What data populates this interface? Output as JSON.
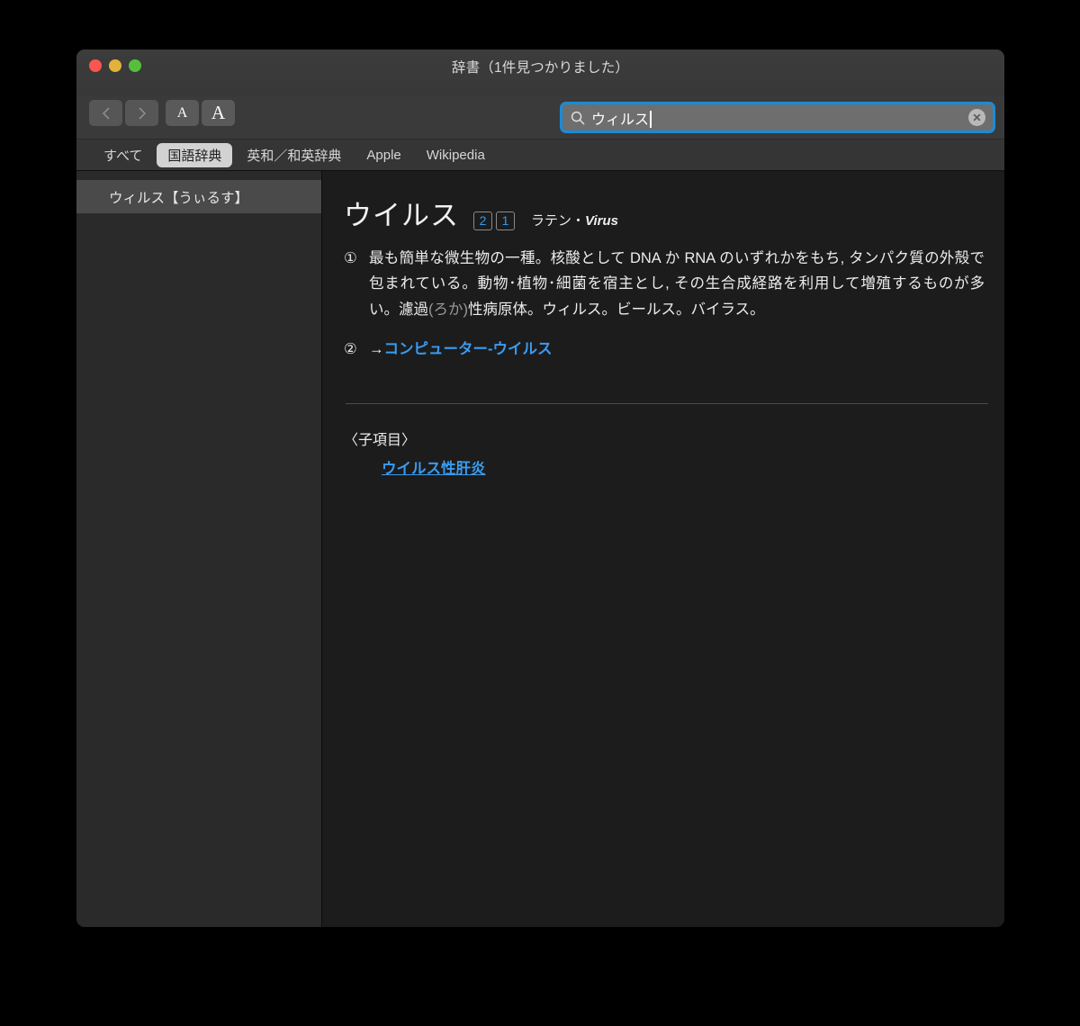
{
  "window": {
    "title": "辞書（1件見つかりました）",
    "traffic_lights": [
      {
        "name": "close",
        "color": "#f9564f"
      },
      {
        "name": "minimize",
        "color": "#e2b23c"
      },
      {
        "name": "maximize",
        "color": "#57c03a"
      }
    ]
  },
  "toolbar": {
    "back_label": "戻る",
    "forward_label": "進む",
    "font_smaller_label": "A",
    "font_larger_label": "A"
  },
  "search": {
    "value": "ウィルス",
    "placeholder": "検索",
    "icon": "search-icon",
    "clear_icon": "clear-icon"
  },
  "tabs": [
    {
      "label": "すべて",
      "active": false
    },
    {
      "label": "国語辞典",
      "active": true
    },
    {
      "label": "英和／和英辞典",
      "active": false
    },
    {
      "label": "Apple",
      "active": false
    },
    {
      "label": "Wikipedia",
      "active": false
    }
  ],
  "sidebar": {
    "items": [
      {
        "label": "ウィルス【うぃるす】",
        "selected": true
      }
    ]
  },
  "entry": {
    "headword": "ウイルス",
    "badges": [
      "2",
      "1"
    ],
    "etymology_prefix": "ラテン・",
    "etymology_word": "Virus",
    "senses": [
      {
        "number": "①",
        "text_before_ruby": "最も簡単な微生物の一種。核酸として DNA か RNA のいずれかをもち, タンパク質の外殻で包まれている。動物･植物･細菌を宿主とし, その生合成経路を利用して増殖するものが多い。濾過",
        "ruby": "(ろか)",
        "text_after_ruby": "性病原体。ウィルス。ビールス。バイラス。"
      },
      {
        "number": "②",
        "arrow": "→",
        "link": "コンピューター-ウイルス"
      }
    ],
    "subentries": {
      "title": "〈子項目〉",
      "items": [
        "ウイルス性肝炎"
      ]
    }
  },
  "colors": {
    "accent_blue": "#3a9bf0",
    "badge_blue": "#2f9bf0",
    "focus_ring": "#1a8cd8",
    "sidebar_bg": "#2a2a2a",
    "content_bg": "#1c1c1c"
  }
}
